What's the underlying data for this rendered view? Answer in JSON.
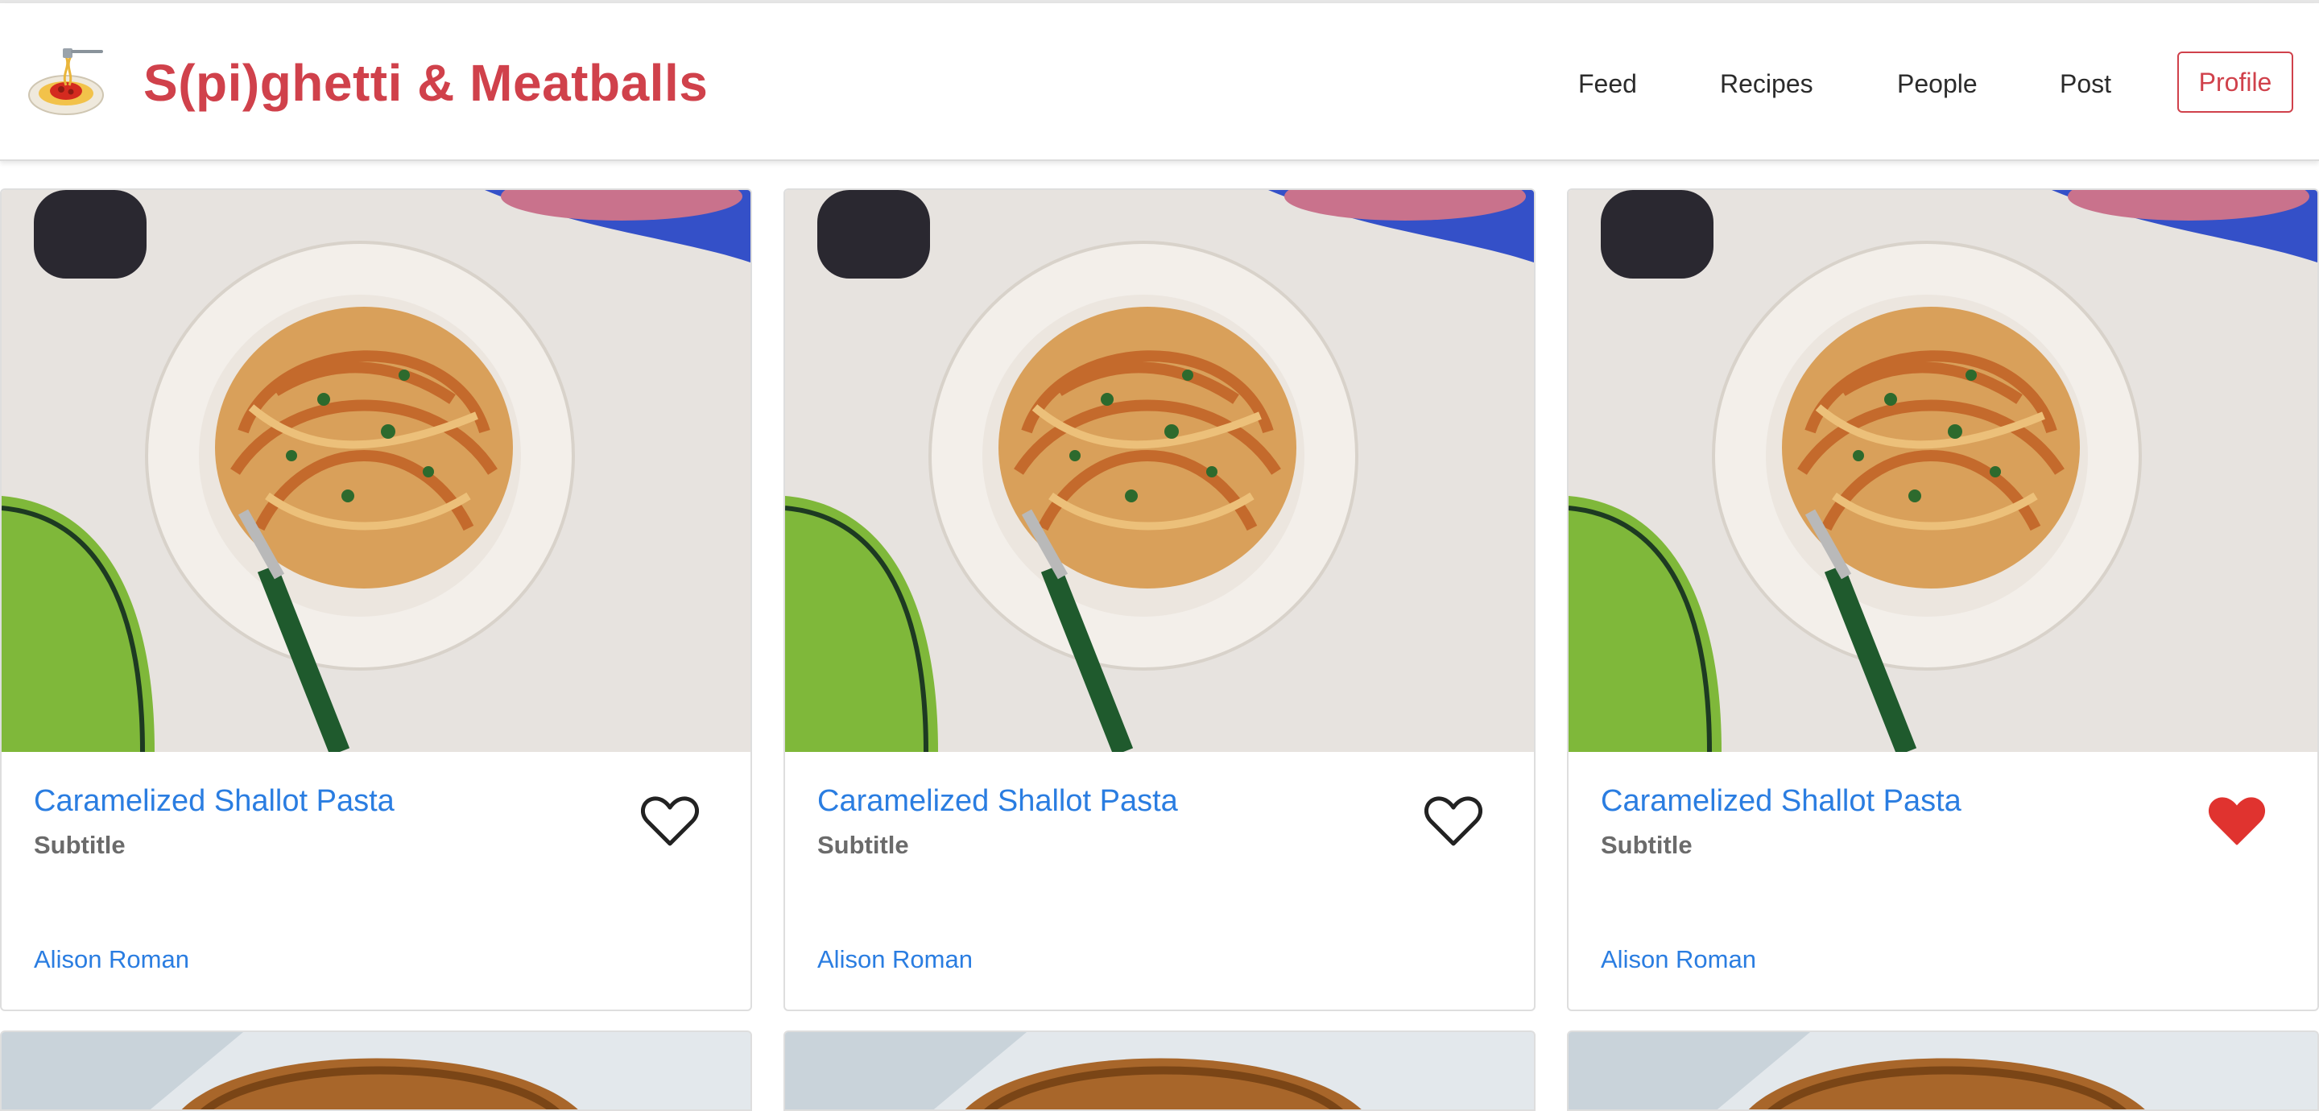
{
  "app": {
    "brand": "S(pi)ghetti & Meatballs",
    "logo_icon": "spaghetti-plate-icon",
    "accent_color": "#d0414b"
  },
  "nav": {
    "items": [
      {
        "label": "Feed"
      },
      {
        "label": "Recipes"
      },
      {
        "label": "People"
      },
      {
        "label": "Post"
      }
    ],
    "profile_label": "Profile"
  },
  "cards": [
    {
      "title": "Caramelized Shallot Pasta",
      "subtitle": "Subtitle",
      "author": "Alison Roman",
      "liked": false,
      "image": "pasta-bowl-photo"
    },
    {
      "title": "Caramelized Shallot Pasta",
      "subtitle": "Subtitle",
      "author": "Alison Roman",
      "liked": false,
      "image": "pasta-bowl-photo"
    },
    {
      "title": "Caramelized Shallot Pasta",
      "subtitle": "Subtitle",
      "author": "Alison Roman",
      "liked": true,
      "image": "pasta-bowl-photo"
    }
  ],
  "second_row": [
    {
      "image": "wooden-bowl-photo"
    },
    {
      "image": "wooden-bowl-photo"
    },
    {
      "image": "wooden-bowl-photo"
    }
  ],
  "colors": {
    "link": "#2a7de1",
    "heart_liked": "#e0332f",
    "heart_outline": "#222222"
  }
}
